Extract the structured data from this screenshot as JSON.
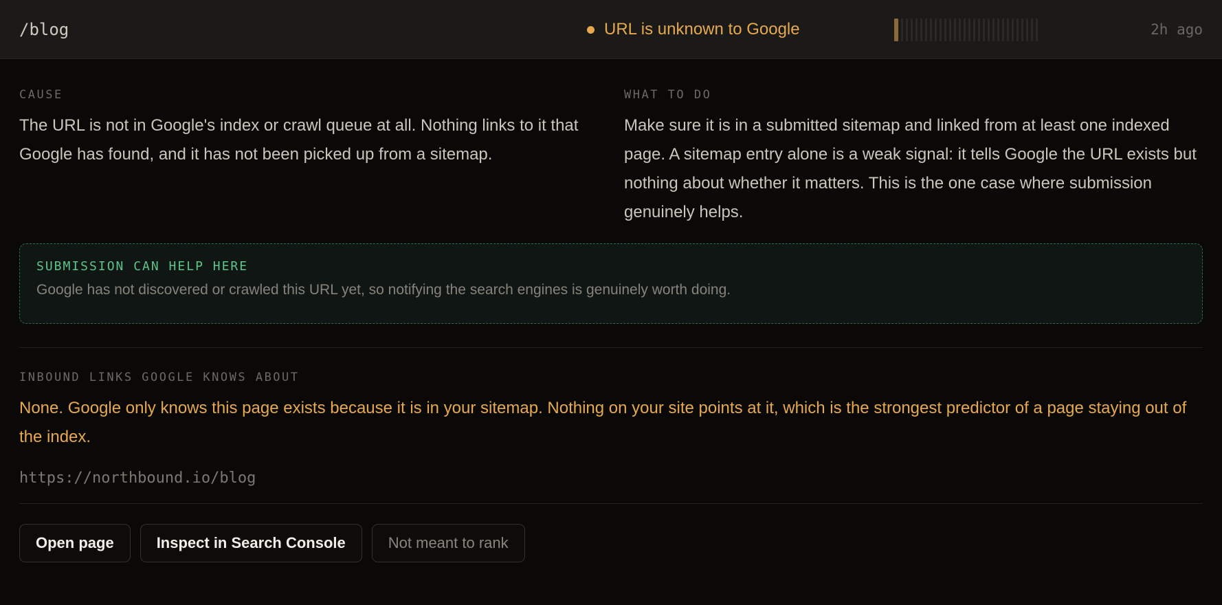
{
  "header": {
    "path": "/blog",
    "status_text": "URL is unknown to Google",
    "status_color": "#e6a94f",
    "time": "2h ago"
  },
  "cause": {
    "label": "CAUSE",
    "text": "The URL is not in Google's index or crawl queue at all. Nothing links to it that Google has found, and it has not been picked up from a sitemap."
  },
  "what_to_do": {
    "label": "WHAT TO DO",
    "text": "Make sure it is in a submitted sitemap and linked from at least one indexed page. A sitemap entry alone is a weak signal: it tells Google the URL exists but nothing about whether it matters. This is the one case where submission genuinely helps."
  },
  "callout": {
    "title": "SUBMISSION CAN HELP HERE",
    "text": "Google has not discovered or crawled this URL yet, so notifying the search engines is genuinely worth doing.",
    "accent_color": "#5ec489"
  },
  "inbound": {
    "label": "INBOUND LINKS GOOGLE KNOWS ABOUT",
    "text": "None. Google only knows this page exists because it is in your sitemap. Nothing on your site points at it, which is the strongest predictor of a page staying out of the index.",
    "url": "https://northbound.io/blog"
  },
  "actions": {
    "open_page": "Open page",
    "inspect": "Inspect in Search Console",
    "not_meant": "Not meant to rank"
  }
}
